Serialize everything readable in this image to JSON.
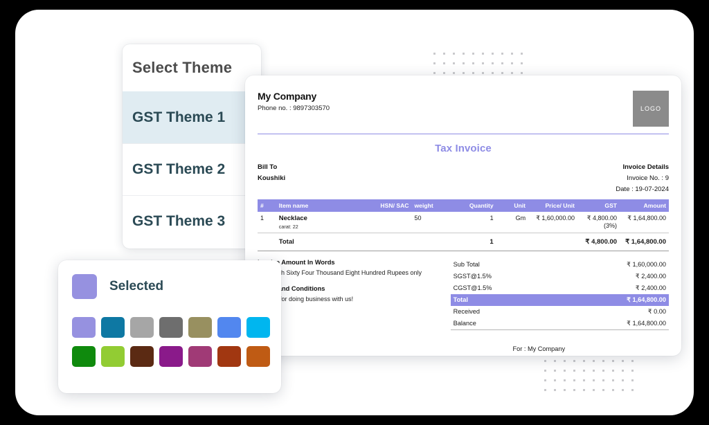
{
  "theme_panel": {
    "title": "Select Theme",
    "items": [
      {
        "label": "GST Theme 1",
        "selected": true
      },
      {
        "label": "GST Theme 2",
        "selected": false
      },
      {
        "label": "GST Theme 3",
        "selected": false
      }
    ]
  },
  "invoice": {
    "company_name": "My Company",
    "company_phone": "Phone no. : 9897303570",
    "logo_text": "LOGO",
    "doc_title": "Tax Invoice",
    "bill_to_label": "Bill To",
    "bill_to_name": "Koushiki",
    "invoice_details_label": "Invoice Details",
    "invoice_no": "Invoice No. : 9",
    "invoice_date": "Date : 19-07-2024",
    "table": {
      "headers": [
        "#",
        "Item name",
        "HSN/ SAC",
        "weight",
        "Quantity",
        "Unit",
        "Price/ Unit",
        "GST",
        "Amount"
      ],
      "rows": [
        {
          "idx": "1",
          "name": "Necklace",
          "sub": "carat: 22",
          "hsn": "",
          "weight": "50",
          "quantity": "1",
          "unit": "Gm",
          "price_unit": "₹ 1,60,000.00",
          "gst": "₹ 4,800.00 (3%)",
          "amount": "₹ 1,64,800.00"
        }
      ],
      "total_row": {
        "label": "Total",
        "quantity": "1",
        "gst": "₹ 4,800.00",
        "amount": "₹ 1,64,800.00"
      }
    },
    "amount_in_words_label": "Invoice Amount In Words",
    "amount_in_words": "One Lakh Sixty Four Thousand Eight Hundred Rupees only",
    "terms_label": "Terms and Conditions",
    "terms_text": "Thanks for doing business with us!",
    "summary": [
      {
        "label": "Sub Total",
        "value": "₹ 1,60,000.00",
        "highlight": false
      },
      {
        "label": "SGST@1.5%",
        "value": "₹ 2,400.00",
        "highlight": false
      },
      {
        "label": "CGST@1.5%",
        "value": "₹ 2,400.00",
        "highlight": false
      },
      {
        "label": "Total",
        "value": "₹ 1,64,800.00",
        "highlight": true
      },
      {
        "label": "Received",
        "value": "₹ 0.00",
        "highlight": false
      },
      {
        "label": "Balance",
        "value": "₹ 1,64,800.00",
        "highlight": false
      }
    ],
    "signature_line": "For : My Company"
  },
  "palette": {
    "selected_label": "Selected",
    "selected_color": "#9691e0",
    "swatches": [
      "#9691e0",
      "#0e78a3",
      "#a6a6a6",
      "#6e6e6e",
      "#989060",
      "#5287ef",
      "#00b6ef",
      "#0f8a0d",
      "#92cc33",
      "#5b2a13",
      "#8a1a8a",
      "#a03a76",
      "#a13711",
      "#bf5b14"
    ]
  },
  "decor": {
    "dot_color": "#c9c9cc",
    "top_dots_cols": 10,
    "top_dots_rows": 3,
    "bottom_dots_cols": 10,
    "bottom_dots_rows": 4
  },
  "accent_color": "#8e8ce5",
  "selected_row_bg": "#e0ecf2"
}
